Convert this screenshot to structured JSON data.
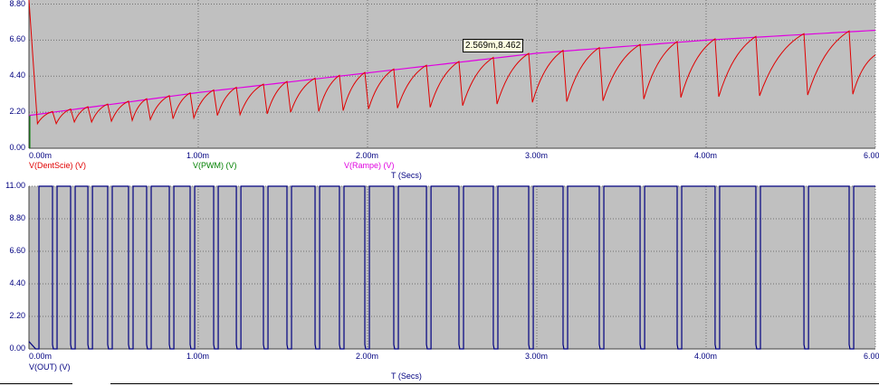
{
  "chart_data": [
    {
      "type": "line",
      "xlabel": "T (Secs)",
      "xlim": [
        0,
        5
      ],
      "ylim": [
        0,
        9.05
      ],
      "x_ticks": [
        "0.00m",
        "1.00m",
        "2.00m",
        "3.00m",
        "4.00m",
        "6.00"
      ],
      "y_ticks": [
        "0.00",
        "2.20",
        "4.40",
        "6.60",
        "8.80"
      ],
      "grid": true,
      "legend": [
        "V(DentScie) (V)",
        "V(PWM) (V)",
        "V(Rampe) (V)"
      ],
      "colors": {
        "dentscie": "#e00000",
        "pwm": "#008000",
        "rampe": "#e000e0",
        "background": "#c0c0c0"
      },
      "cursor_readout": "2.569m,8.462",
      "series": [
        {
          "name": "V(DentScie) (V)",
          "start": [
            0,
            10.5
          ],
          "first_trough": [
            0.05,
            1.5
          ],
          "peaks_ms": [
            0.139,
            0.246,
            0.348,
            0.465,
            0.588,
            0.695,
            0.829,
            0.952,
            1.091,
            1.225,
            1.385,
            1.524,
            1.69,
            1.834,
            1.984,
            2.155,
            2.348,
            2.54,
            2.743,
            2.952,
            3.155,
            3.369,
            3.61,
            3.829,
            4.053,
            4.294,
            4.578,
            4.845
          ],
          "trough_v": [
            1.5,
            1.6,
            1.6,
            1.65,
            1.7,
            1.75,
            1.8,
            1.85,
            2.0,
            2.05,
            2.1,
            2.2,
            2.25,
            2.3,
            2.4,
            2.45,
            2.5,
            2.6,
            2.7,
            2.8,
            2.85,
            2.9,
            3.0,
            3.1,
            3.15,
            3.2,
            3.25,
            3.3
          ],
          "end_v": 5.7
        },
        {
          "name": "V(Rampe) (V)",
          "x": [
            0,
            1,
            2,
            3,
            4,
            5
          ],
          "y": [
            2.0,
            3.4,
            4.6,
            5.8,
            6.6,
            7.2
          ]
        },
        {
          "name": "V(PWM) (V)",
          "x": [
            0,
            0
          ],
          "y": [
            0,
            2.0
          ]
        }
      ]
    },
    {
      "type": "line",
      "xlabel": "T (Secs)",
      "xlim": [
        0,
        5
      ],
      "ylim": [
        0,
        11
      ],
      "x_ticks": [
        "0.00m",
        "1.00m",
        "2.00m",
        "3.00m",
        "4.00m",
        "6.00"
      ],
      "y_ticks": [
        "0.00",
        "2.20",
        "4.40",
        "6.60",
        "8.80",
        "11.00"
      ],
      "grid": true,
      "legend": [
        "V(OUT) (V)"
      ],
      "colors": {
        "out": "#000080",
        "background": "#c0c0c0"
      },
      "series": [
        {
          "name": "V(OUT) (V)",
          "high_v": 11,
          "low_v": 0,
          "initial_low_until_ms": 0.059,
          "pulse_width_ms": 0.027,
          "low_pulses_ms": [
            0.139,
            0.246,
            0.348,
            0.465,
            0.588,
            0.695,
            0.829,
            0.952,
            1.091,
            1.225,
            1.385,
            1.524,
            1.69,
            1.834,
            1.984,
            2.155,
            2.348,
            2.54,
            2.743,
            2.952,
            3.155,
            3.369,
            3.61,
            3.829,
            4.053,
            4.294,
            4.578,
            4.845
          ]
        }
      ]
    }
  ]
}
